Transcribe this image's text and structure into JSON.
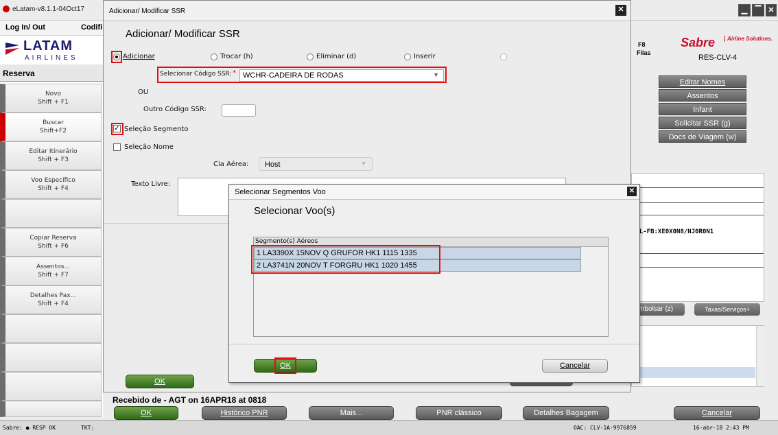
{
  "app": {
    "window_title": "eLatam-v8.1.1-04Oct17",
    "menu": [
      "Log In/ Out",
      "Codifi"
    ],
    "logo_top": "LATAM",
    "logo_bottom": "AIRLINES",
    "reserva_label": "Reserva"
  },
  "sidebar": {
    "items": [
      {
        "label": "Novo",
        "shortcut": "Shift + F1"
      },
      {
        "label": "Buscar",
        "shortcut": "Shift+F2"
      },
      {
        "label": "Editar Itinerário",
        "shortcut": "Shift + F3"
      },
      {
        "label": "Voo Específico",
        "shortcut": "Shift + F4"
      },
      {
        "label": "",
        "shortcut": ""
      },
      {
        "label": "Copiar Reserva",
        "shortcut": "Shift + F6"
      },
      {
        "label": "Assentos...",
        "shortcut": "Shift + F7"
      },
      {
        "label": "Detalhes Pax...",
        "shortcut": "Shift + F4"
      },
      {
        "label": "",
        "shortcut": ""
      },
      {
        "label": "",
        "shortcut": ""
      },
      {
        "label": "",
        "shortcut": ""
      },
      {
        "label": "",
        "shortcut": ""
      }
    ]
  },
  "right_panel": {
    "f8": "F8",
    "filas": "Filas",
    "sabre": "Sabre",
    "airline_solutions": "Airline Solutions.",
    "res_code": "RES-CLV-4",
    "buttons": [
      "Editar Nomes",
      "Assentos",
      "Infant",
      "Solicitar SSR (g)",
      "Docs de Viagem (w)"
    ],
    "fare_text": "BRL-FB:XE0X0N8/NJ0R0N1",
    "reembolsar": "eembolsar (z)",
    "taxas": "Taxas/Serviços+"
  },
  "ssr_dialog": {
    "window_title": "Adicionar/ Modificar SSR",
    "heading": "Adicionar/ Modificar SSR",
    "options": [
      "Adicionar",
      "Trocar (h)",
      "Eliminar (d)",
      "Inserir"
    ],
    "ssr_code_label": "Selecionar Código SSR:",
    "required_mark": "*",
    "ssr_code_value": "WCHR-CADEIRA DE RODAS",
    "ou": "OU",
    "outro_label": "Outro Código SSR:",
    "selecao_segmento": "Seleção Segmento",
    "selecao_nome": "Seleção Nome",
    "cia_label": "Cia Aérea:",
    "cia_value": "Host",
    "texto_livre": "Texto Livre:",
    "ok": "OK",
    "cancelar": "Cancelar"
  },
  "segment_dialog": {
    "window_title": "Selecionar Segmentos Voo",
    "heading": "Selecionar Voo(s)",
    "column_header": "Segmento(s) Aéreos",
    "rows": [
      "1 LA3390X 15NOV Q GRUFOR HK1  1115  1335",
      "2 LA3741N 20NOV T FORGRU HK1  1020  1455"
    ],
    "ok": "OK",
    "cancelar": "Cancelar"
  },
  "bottom": {
    "recebido": "Recebido de - AGT on 16APR18 at 0818",
    "buttons": [
      "OK",
      "Histórico PNR",
      "Mais...",
      "PNR clássico",
      "Detalhes Bagagem",
      "Cancelar"
    ]
  },
  "status": {
    "sabre": "Sabre: ● RESP OK",
    "tkt": "TKT:",
    "oac": "OAC: CLV-1A-9976859",
    "datetime": "16-abr-18 2:43 PM"
  }
}
